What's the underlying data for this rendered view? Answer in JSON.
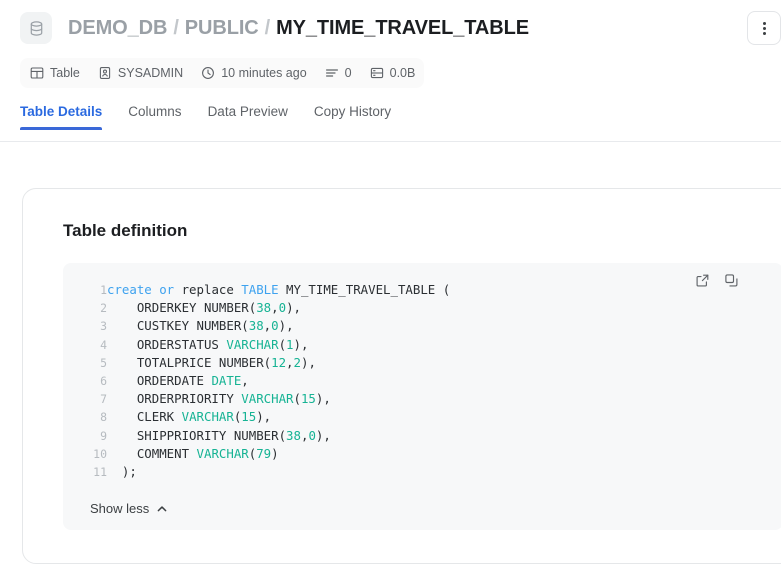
{
  "header": {
    "db_icon": "database-icon",
    "breadcrumb": {
      "database": "DEMO_DB",
      "schema": "PUBLIC",
      "separator": "/",
      "table": "MY_TIME_TRAVEL_TABLE"
    },
    "more_button": "more-options"
  },
  "meta": [
    {
      "icon": "table-grid-icon",
      "label": "Table"
    },
    {
      "icon": "user-badge-icon",
      "label": "SYSADMIN"
    },
    {
      "icon": "clock-icon",
      "label": "10 minutes ago"
    },
    {
      "icon": "rows-icon",
      "label": "0"
    },
    {
      "icon": "storage-icon",
      "label": "0.0B"
    }
  ],
  "tabs": [
    {
      "label": "Table Details",
      "active": true
    },
    {
      "label": "Columns",
      "active": false
    },
    {
      "label": "Data Preview",
      "active": false
    },
    {
      "label": "Copy History",
      "active": false
    }
  ],
  "card": {
    "title": "Table definition",
    "actions": {
      "expand": "open-in-new-icon",
      "copy": "copy-icon"
    },
    "show_toggle": {
      "label": "Show less",
      "icon": "chevron-up-icon"
    },
    "code": {
      "language": "sql",
      "lines": [
        {
          "n": "1",
          "text": "create or replace TABLE MY_TIME_TRAVEL_TABLE ("
        },
        {
          "n": "2",
          "text": "    ORDERKEY NUMBER(38,0),"
        },
        {
          "n": "3",
          "text": "    CUSTKEY NUMBER(38,0),"
        },
        {
          "n": "4",
          "text": "    ORDERSTATUS VARCHAR(1),"
        },
        {
          "n": "5",
          "text": "    TOTALPRICE NUMBER(12,2),"
        },
        {
          "n": "6",
          "text": "    ORDERDATE DATE,"
        },
        {
          "n": "7",
          "text": "    ORDERPRIORITY VARCHAR(15),"
        },
        {
          "n": "8",
          "text": "    CLERK VARCHAR(15),"
        },
        {
          "n": "9",
          "text": "    SHIPPRIORITY NUMBER(38,0),"
        },
        {
          "n": "10",
          "text": "    COMMENT VARCHAR(79)"
        },
        {
          "n": "11",
          "text": ");"
        }
      ]
    }
  },
  "colors": {
    "accent": "#3a68d8",
    "keyword": "#3ea2ef",
    "type": "#16b394",
    "code_bg": "#f7f8f9",
    "text": "#1c1e21",
    "muted": "#5f6368"
  }
}
